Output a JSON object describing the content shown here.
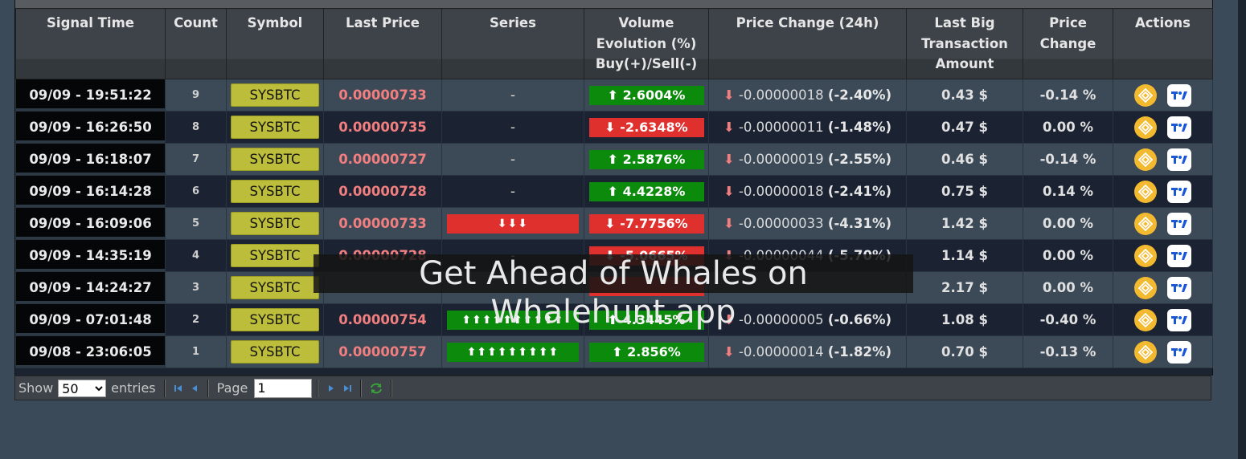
{
  "columns": [
    "Signal Time",
    "Count",
    "Symbol",
    "Last Price",
    "Series",
    "Volume Evolution (%) Buy(+)/Sell(-)",
    "Price Change (24h)",
    "Last Big Transaction Amount",
    "Price Change",
    "Actions"
  ],
  "rows": [
    {
      "time": "09/09 - 19:51:22",
      "count": "9",
      "symbol": "SYSBTC",
      "last_price": "0.00000733",
      "series": "-",
      "series_color": "",
      "volume": "⬆ 2.6004%",
      "volume_color": "green",
      "chg_arrow": "⬇",
      "chg_value": "-0.00000018",
      "chg_pct": "(-2.40%)",
      "big_tx": "0.43 $",
      "price_change": "-0.14 %"
    },
    {
      "time": "09/09 - 16:26:50",
      "count": "8",
      "symbol": "SYSBTC",
      "last_price": "0.00000735",
      "series": "-",
      "series_color": "",
      "volume": "⬇ -2.6348%",
      "volume_color": "red",
      "chg_arrow": "⬇",
      "chg_value": "-0.00000011",
      "chg_pct": "(-1.48%)",
      "big_tx": "0.47 $",
      "price_change": "0.00 %"
    },
    {
      "time": "09/09 - 16:18:07",
      "count": "7",
      "symbol": "SYSBTC",
      "last_price": "0.00000727",
      "series": "-",
      "series_color": "",
      "volume": "⬆ 2.5876%",
      "volume_color": "green",
      "chg_arrow": "⬇",
      "chg_value": "-0.00000019",
      "chg_pct": "(-2.55%)",
      "big_tx": "0.46 $",
      "price_change": "-0.14 %"
    },
    {
      "time": "09/09 - 16:14:28",
      "count": "6",
      "symbol": "SYSBTC",
      "last_price": "0.00000728",
      "series": "-",
      "series_color": "",
      "volume": "⬆ 4.4228%",
      "volume_color": "green",
      "chg_arrow": "⬇",
      "chg_value": "-0.00000018",
      "chg_pct": "(-2.41%)",
      "big_tx": "0.75 $",
      "price_change": "0.14 %"
    },
    {
      "time": "09/09 - 16:09:06",
      "count": "5",
      "symbol": "SYSBTC",
      "last_price": "0.00000733",
      "series": "⬇⬇⬇",
      "series_color": "red",
      "volume": "⬇ -7.7756%",
      "volume_color": "red",
      "chg_arrow": "⬇",
      "chg_value": "-0.00000033",
      "chg_pct": "(-4.31%)",
      "big_tx": "1.42 $",
      "price_change": "0.00 %"
    },
    {
      "time": "09/09 - 14:35:19",
      "count": "4",
      "symbol": "SYSBTC",
      "last_price": "0.00000728",
      "series": "-",
      "series_color": "",
      "volume": "⬇ -5.0665%",
      "volume_color": "red",
      "chg_arrow": "⬇",
      "chg_value": "-0.00000044",
      "chg_pct": "(-5.70%)",
      "big_tx": "1.14 $",
      "price_change": "0.00 %"
    },
    {
      "time": "09/09 - 14:24:27",
      "count": "3",
      "symbol": "SYSBTC",
      "last_price": "",
      "series": "",
      "series_color": "",
      "volume": "",
      "volume_color": "red",
      "chg_arrow": "",
      "chg_value": "",
      "chg_pct": "",
      "big_tx": "2.17 $",
      "price_change": "0.00 %"
    },
    {
      "time": "09/09 - 07:01:48",
      "count": "2",
      "symbol": "SYSBTC",
      "last_price": "0.00000754",
      "series": "⬆⬆⬆⬆⬆⬆⬆⬆⬆⬆",
      "series_color": "green",
      "volume": "⬆ 4.3445%",
      "volume_color": "green",
      "chg_arrow": "⬇",
      "chg_value": "-0.00000005",
      "chg_pct": "(-0.66%)",
      "big_tx": "1.08 $",
      "price_change": "-0.40 %"
    },
    {
      "time": "09/08 - 23:06:05",
      "count": "1",
      "symbol": "SYSBTC",
      "last_price": "0.00000757",
      "series": "⬆⬆⬆⬆⬆⬆⬆⬆⬆",
      "series_color": "green",
      "volume": "⬆ 2.856%",
      "volume_color": "green",
      "chg_arrow": "⬇",
      "chg_value": "-0.00000014",
      "chg_pct": "(-1.82%)",
      "big_tx": "0.70 $",
      "price_change": "-0.13 %"
    }
  ],
  "pager": {
    "show_label": "Show",
    "entries_value": "50",
    "entries_label": "entries",
    "page_label": "Page",
    "page_value": "1"
  },
  "watermark": "Get Ahead of Whales on Whalehunt.app",
  "colors": {
    "buy": "#0c8a0c",
    "sell": "#e0302e",
    "symbol_bg": "#bcbd3a",
    "price_text": "#f27f7f",
    "binance": "#f3ba2f"
  }
}
